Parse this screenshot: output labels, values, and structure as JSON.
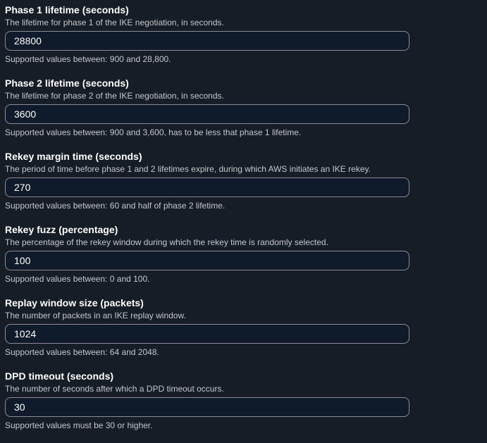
{
  "fields": [
    {
      "label": "Phase 1 lifetime (seconds)",
      "description": "The lifetime for phase 1 of the IKE negotiation, in seconds.",
      "value": "28800",
      "hint": "Supported values between: 900 and 28,800."
    },
    {
      "label": "Phase 2 lifetime (seconds)",
      "description": "The lifetime for phase 2 of the IKE negotiation, in seconds.",
      "value": "3600",
      "hint": "Supported values between: 900 and 3,600, has to be less that phase 1 lifetime."
    },
    {
      "label": "Rekey margin time (seconds)",
      "description": "The period of time before phase 1 and 2 lifetimes expire, during which AWS initiates an IKE rekey.",
      "value": "270",
      "hint": "Supported values between: 60 and half of phase 2 lifetime."
    },
    {
      "label": "Rekey fuzz (percentage)",
      "description": "The percentage of the rekey window during which the rekey time is randomly selected.",
      "value": "100",
      "hint": "Supported values between: 0 and 100."
    },
    {
      "label": "Replay window size (packets)",
      "description": "The number of packets in an IKE replay window.",
      "value": "1024",
      "hint": "Supported values between: 64 and 2048."
    },
    {
      "label": "DPD timeout (seconds)",
      "description": "The number of seconds after which a DPD timeout occurs.",
      "value": "30",
      "hint": "Supported values must be 30 or higher."
    }
  ],
  "colors": {
    "background": "#161d26",
    "input_background": "#0f1b2a",
    "input_border": "#8c8c94",
    "label": "#ffffff",
    "secondary_text": "#c6c6cd"
  }
}
